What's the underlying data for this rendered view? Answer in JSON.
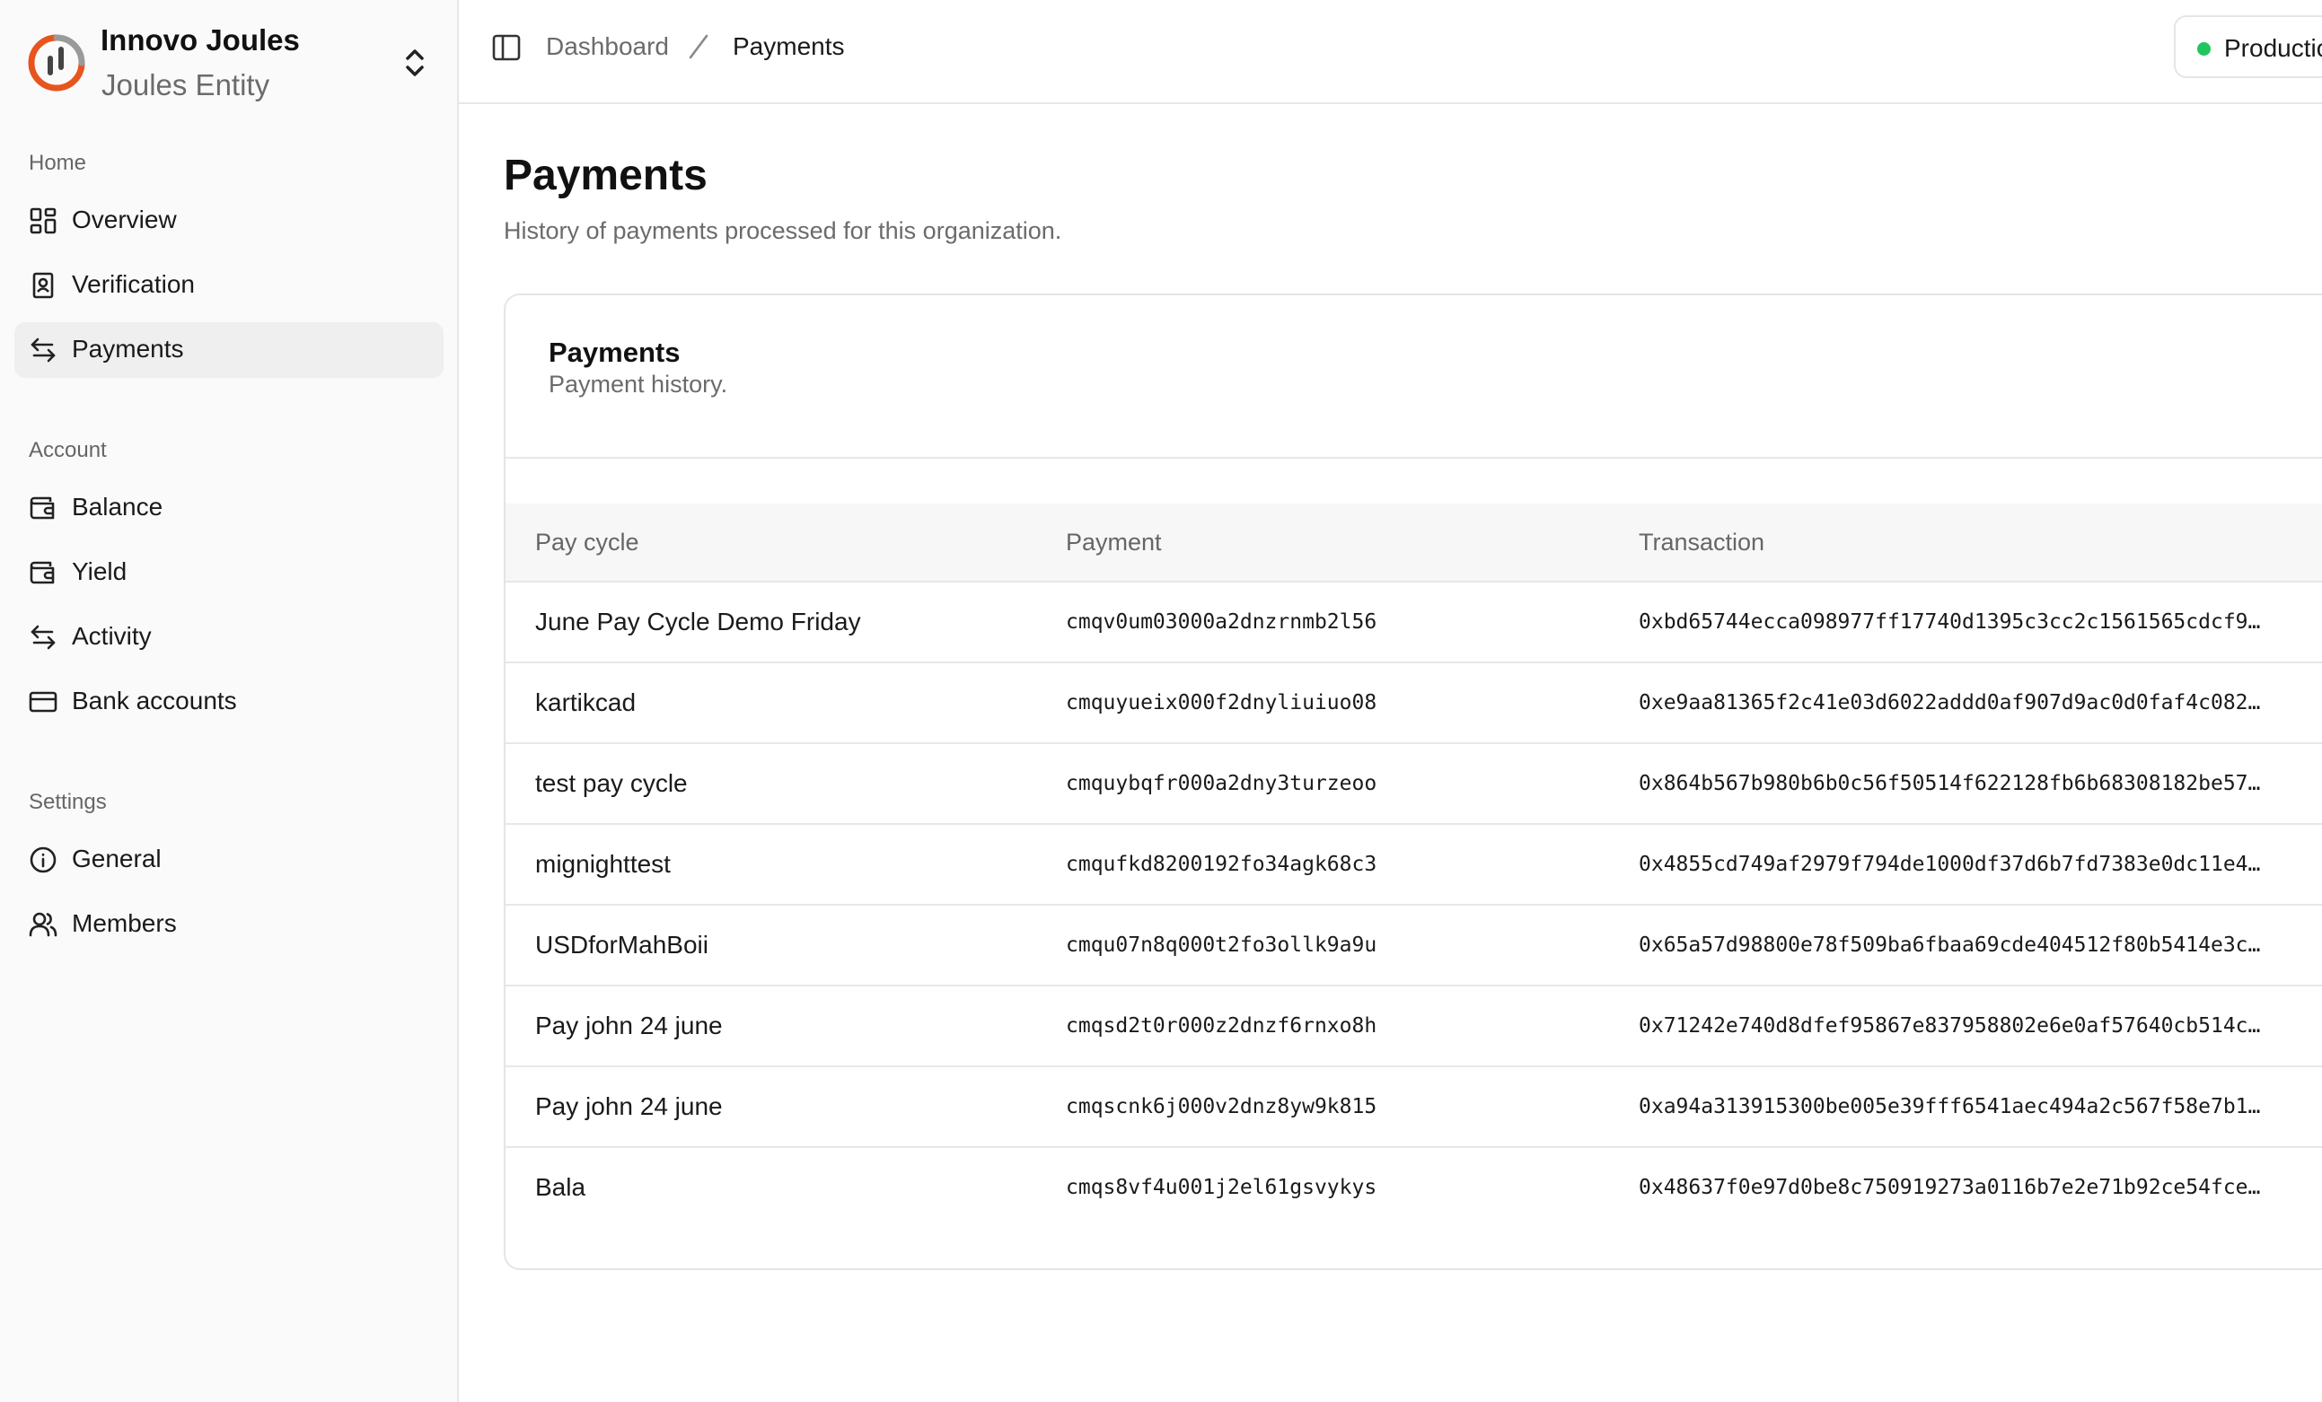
{
  "org": {
    "name": "Innovo Joules",
    "entity": "Joules Entity",
    "logo_color": "#e8541e"
  },
  "sidebar": {
    "sections": [
      {
        "label": "Home",
        "items": [
          {
            "label": "Overview",
            "icon": "grid-icon"
          },
          {
            "label": "Verification",
            "icon": "id-badge-icon"
          },
          {
            "label": "Payments",
            "icon": "arrows-left-right-icon",
            "active": true
          }
        ]
      },
      {
        "label": "Account",
        "items": [
          {
            "label": "Balance",
            "icon": "wallet-icon"
          },
          {
            "label": "Yield",
            "icon": "wallet-icon"
          },
          {
            "label": "Activity",
            "icon": "arrows-left-right-icon"
          },
          {
            "label": "Bank accounts",
            "icon": "credit-card-icon"
          }
        ]
      },
      {
        "label": "Settings",
        "items": [
          {
            "label": "General",
            "icon": "info-circle-icon"
          },
          {
            "label": "Members",
            "icon": "users-icon"
          }
        ]
      }
    ]
  },
  "header": {
    "breadcrumb_root": "Dashboard",
    "breadcrumb_current": "Payments",
    "environment_label": "Production",
    "environment_color": "#22c55e"
  },
  "main": {
    "title": "Payments",
    "subtitle": "History of payments processed for this organization.",
    "card": {
      "title": "Payments",
      "subtitle": "Payment history.",
      "columns": [
        "Pay cycle",
        "Payment",
        "Transaction"
      ],
      "rows": [
        {
          "cycle": "June Pay Cycle Demo Friday",
          "payment": "cmqv0um03000a2dnzrnmb2l56",
          "transaction": "0xbd65744ecca098977ff17740d1395c3cc2c1561565cdcf9…"
        },
        {
          "cycle": "kartikcad",
          "payment": "cmquyueix000f2dnyliuiuo08",
          "transaction": "0xe9aa81365f2c41e03d6022addd0af907d9ac0d0faf4c082…"
        },
        {
          "cycle": "test pay cycle",
          "payment": "cmquybqfr000a2dny3turzeoo",
          "transaction": "0x864b567b980b6b0c56f50514f622128fb6b68308182be57…"
        },
        {
          "cycle": "mignighttest",
          "payment": "cmqufkd8200192fo34agk68c3",
          "transaction": "0x4855cd749af2979f794de1000df37d6b7fd7383e0dc11e4…"
        },
        {
          "cycle": "USDforMahBoii",
          "payment": "cmqu07n8q000t2fo3ollk9a9u",
          "transaction": "0x65a57d98800e78f509ba6fbaa69cde404512f80b5414e3c…"
        },
        {
          "cycle": "Pay john 24 june",
          "payment": "cmqsd2t0r000z2dnzf6rnxo8h",
          "transaction": "0x71242e740d8dfef95867e837958802e6e0af57640cb514c…"
        },
        {
          "cycle": "Pay john 24 june",
          "payment": "cmqscnk6j000v2dnz8yw9k815",
          "transaction": "0xa94a313915300be005e39fff6541aec494a2c567f58e7b1…"
        },
        {
          "cycle": "Bala",
          "payment": "cmqs8vf4u001j2el61gsvykys",
          "transaction": "0x48637f0e97d0be8c750919273a0116b7e2e71b92ce54fce…"
        }
      ]
    }
  }
}
